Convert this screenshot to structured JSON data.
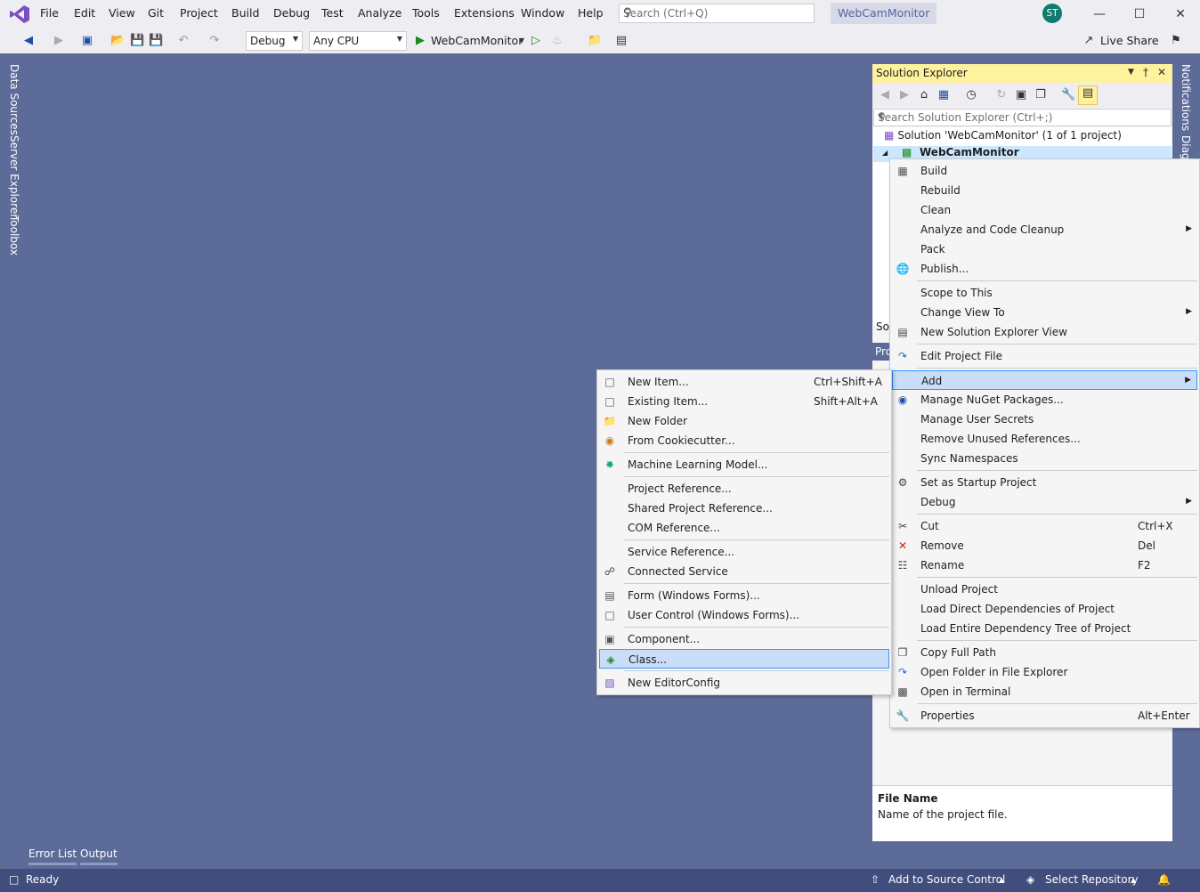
{
  "menubar": {
    "items": [
      "File",
      "Edit",
      "View",
      "Git",
      "Project",
      "Build",
      "Debug",
      "Test",
      "Analyze",
      "Tools",
      "Extensions",
      "Window",
      "Help"
    ],
    "search_placeholder": "Search (Ctrl+Q)",
    "solution_name": "WebCamMonitor",
    "avatar_initials": "ST"
  },
  "toolbar": {
    "configuration": "Debug",
    "platform": "Any CPU",
    "start_target": "WebCamMonitor",
    "live_share": "Live Share"
  },
  "side_tabs": {
    "left": [
      "Data Sources",
      "Server Explorer",
      "Toolbox"
    ],
    "right": [
      "Notifications",
      "Diag"
    ]
  },
  "solution_explorer": {
    "title": "Solution Explorer",
    "search_placeholder": "Search Solution Explorer (Ctrl+;)",
    "solution_node": "Solution 'WebCamMonitor' (1 of 1 project)",
    "project_node": "WebCamMonitor",
    "footer_fragment": "So",
    "properties_fragment": "Pro"
  },
  "properties": {
    "field_name": "File Name",
    "field_desc": "Name of the project file."
  },
  "project_context_menu": [
    {
      "label": "Build",
      "icon": "build-icon"
    },
    {
      "label": "Rebuild"
    },
    {
      "label": "Clean"
    },
    {
      "label": "Analyze and Code Cleanup",
      "submenu": true
    },
    {
      "label": "Pack"
    },
    {
      "label": "Publish...",
      "icon": "globe-icon"
    },
    {
      "label": "Scope to This"
    },
    {
      "label": "Change View To",
      "submenu": true
    },
    {
      "label": "New Solution Explorer View",
      "icon": "window-icon"
    },
    {
      "label": "Edit Project File",
      "icon": "redo-icon"
    },
    {
      "label": "Add",
      "submenu": true,
      "highlighted": true
    },
    {
      "label": "Manage NuGet Packages...",
      "icon": "nuget-icon"
    },
    {
      "label": "Manage User Secrets"
    },
    {
      "label": "Remove Unused References..."
    },
    {
      "label": "Sync Namespaces"
    },
    {
      "label": "Set as Startup Project",
      "icon": "gear-icon"
    },
    {
      "label": "Debug",
      "submenu": true
    },
    {
      "label": "Cut",
      "shortcut": "Ctrl+X",
      "icon": "scissors-icon"
    },
    {
      "label": "Remove",
      "shortcut": "Del",
      "icon": "close-icon"
    },
    {
      "label": "Rename",
      "shortcut": "F2",
      "icon": "rename-icon"
    },
    {
      "label": "Unload Project"
    },
    {
      "label": "Load Direct Dependencies of Project"
    },
    {
      "label": "Load Entire Dependency Tree of Project"
    },
    {
      "label": "Copy Full Path",
      "icon": "copy-icon"
    },
    {
      "label": "Open Folder in File Explorer",
      "icon": "redo-icon"
    },
    {
      "label": "Open in Terminal",
      "icon": "terminal-icon"
    },
    {
      "label": "Properties",
      "shortcut": "Alt+Enter",
      "icon": "wrench-icon"
    }
  ],
  "add_submenu": [
    {
      "label": "New Item...",
      "shortcut": "Ctrl+Shift+A",
      "icon": "new-item-icon"
    },
    {
      "label": "Existing Item...",
      "shortcut": "Shift+Alt+A",
      "icon": "existing-item-icon"
    },
    {
      "label": "New Folder",
      "icon": "folder-icon"
    },
    {
      "label": "From Cookiecutter...",
      "icon": "cookiecutter-icon"
    },
    {
      "label": "Machine Learning Model...",
      "icon": "ml-icon"
    },
    {
      "label": "Project Reference..."
    },
    {
      "label": "Shared Project Reference..."
    },
    {
      "label": "COM Reference..."
    },
    {
      "label": "Service Reference..."
    },
    {
      "label": "Connected Service",
      "icon": "connected-service-icon"
    },
    {
      "label": "Form (Windows Forms)...",
      "icon": "form-icon"
    },
    {
      "label": "User Control (Windows Forms)...",
      "icon": "user-control-icon"
    },
    {
      "label": "Component...",
      "icon": "component-icon"
    },
    {
      "label": "Class...",
      "icon": "class-icon",
      "highlighted": true
    },
    {
      "label": "New EditorConfig",
      "icon": "editorconfig-icon"
    }
  ],
  "bottom_tabs": [
    "Error List",
    "Output"
  ],
  "status": {
    "ready": "Ready",
    "source_control": "Add to Source Control",
    "repository": "Select Repository"
  },
  "colors": {
    "background": "#5d6b99",
    "statusbar": "#414d7c",
    "panel_title": "#fff29d",
    "highlight": "#c9ddf9"
  }
}
